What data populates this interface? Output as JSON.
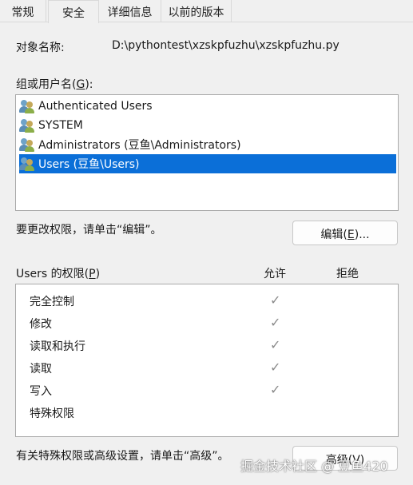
{
  "tabs": [
    {
      "label": "常规"
    },
    {
      "label": "安全"
    },
    {
      "label": "详细信息"
    },
    {
      "label": "以前的版本"
    }
  ],
  "active_tab": "安全",
  "object": {
    "label": "对象名称:",
    "value": "D:\\pythontest\\xzskpfuzhu\\xzskpfuzhu.py"
  },
  "groups": {
    "label_prefix": "组或用户名(",
    "label_key": "G",
    "label_suffix": "):",
    "items": [
      {
        "name": "Authenticated Users",
        "selected": false
      },
      {
        "name": "SYSTEM",
        "selected": false
      },
      {
        "name": "Administrators (豆鱼\\Administrators)",
        "selected": false
      },
      {
        "name": "Users (豆鱼\\Users)",
        "selected": true
      }
    ]
  },
  "edit": {
    "prompt": "要更改权限，请单击“编辑”。",
    "button_prefix": "编辑(",
    "button_key": "E",
    "button_suffix": ")..."
  },
  "permissions": {
    "label_prefix": "Users 的权限(",
    "label_key": "P",
    "label_suffix": ")",
    "allow_header": "允许",
    "deny_header": "拒绝",
    "check_glyph": "✓",
    "rows": [
      {
        "name": "完全控制",
        "allow": true,
        "deny": false
      },
      {
        "name": "修改",
        "allow": true,
        "deny": false
      },
      {
        "name": "读取和执行",
        "allow": true,
        "deny": false
      },
      {
        "name": "读取",
        "allow": true,
        "deny": false
      },
      {
        "name": "写入",
        "allow": true,
        "deny": false
      },
      {
        "name": "特殊权限",
        "allow": false,
        "deny": false
      }
    ]
  },
  "advanced": {
    "prompt": "有关特殊权限或高级设置，请单击“高级”。",
    "button_label": "高级(V)"
  },
  "watermark": "掘金技术社区 @ 豆鱼420",
  "colors": {
    "selection": "#0b6fd8",
    "checkmark": "#8a8a8a",
    "background": "#f0f0f0"
  }
}
